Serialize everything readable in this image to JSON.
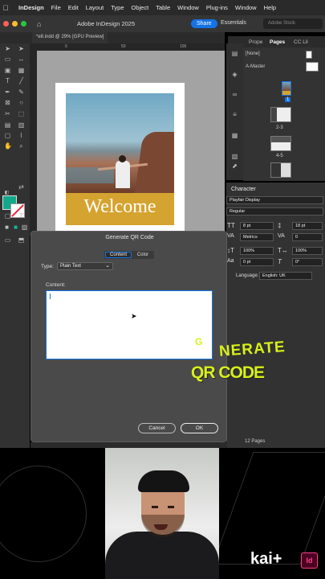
{
  "menubar": {
    "app": "InDesign",
    "items": [
      "File",
      "Edit",
      "Layout",
      "Type",
      "Object",
      "Table",
      "Window",
      "Plug-ins",
      "Window",
      "Help"
    ]
  },
  "window": {
    "title": "Adobe InDesign 2025",
    "share": "Share",
    "workspace": "Essentials",
    "stock_placeholder": "Adobe Stock"
  },
  "document": {
    "tab": "*e8.indd @ 29% [GPU Preview]",
    "ruler_labels": [
      "0",
      "50",
      "100"
    ],
    "welcome": "Welcome"
  },
  "pages_panel": {
    "tabs": [
      "Prope",
      "Pages",
      "CC Lil"
    ],
    "items": [
      "[None]",
      "A-Master"
    ],
    "spreads": [
      "1",
      "2-3",
      "4-5"
    ],
    "status": "12 Pages"
  },
  "character_panel": {
    "title": "Character",
    "font": "Playfair Display",
    "style": "Regular",
    "size": "8 pt",
    "leading": "18 pt",
    "kerning": "Metrics",
    "tracking": "0",
    "vscale": "100%",
    "hscale": "100%",
    "baseline": "0 pt",
    "skew": "0°",
    "language_label": "Language:",
    "language": "English: UK"
  },
  "dialog": {
    "title": "Generate QR Code",
    "tabs": {
      "content": "Content",
      "color": "Color"
    },
    "type_label": "Type:",
    "type_value": "Plain Text",
    "content_label": "Content:",
    "cancel": "Cancel",
    "ok": "OK"
  },
  "overlay": {
    "g": "G",
    "nerate": "NERATE",
    "qr": "QR CODE"
  },
  "branding": {
    "logo": "kai+",
    "badge": "Id"
  }
}
